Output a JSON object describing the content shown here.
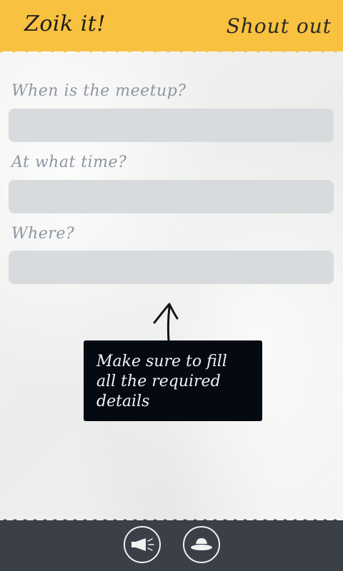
{
  "header": {
    "app_title": "Zoik it!",
    "page_title": "Shout out",
    "color": "#f8c13f"
  },
  "form": {
    "fields": [
      {
        "label": "When is the meetup?",
        "value": ""
      },
      {
        "label": "At what time?",
        "value": ""
      },
      {
        "label": "Where?",
        "value": ""
      }
    ]
  },
  "tooltip": {
    "line1": "Make sure to fill",
    "line2": "all the required",
    "line3": "details"
  },
  "appbar": {
    "background": "#3b3f47",
    "buttons": [
      {
        "icon": "megaphone-icon"
      },
      {
        "icon": "hat-icon"
      }
    ]
  }
}
